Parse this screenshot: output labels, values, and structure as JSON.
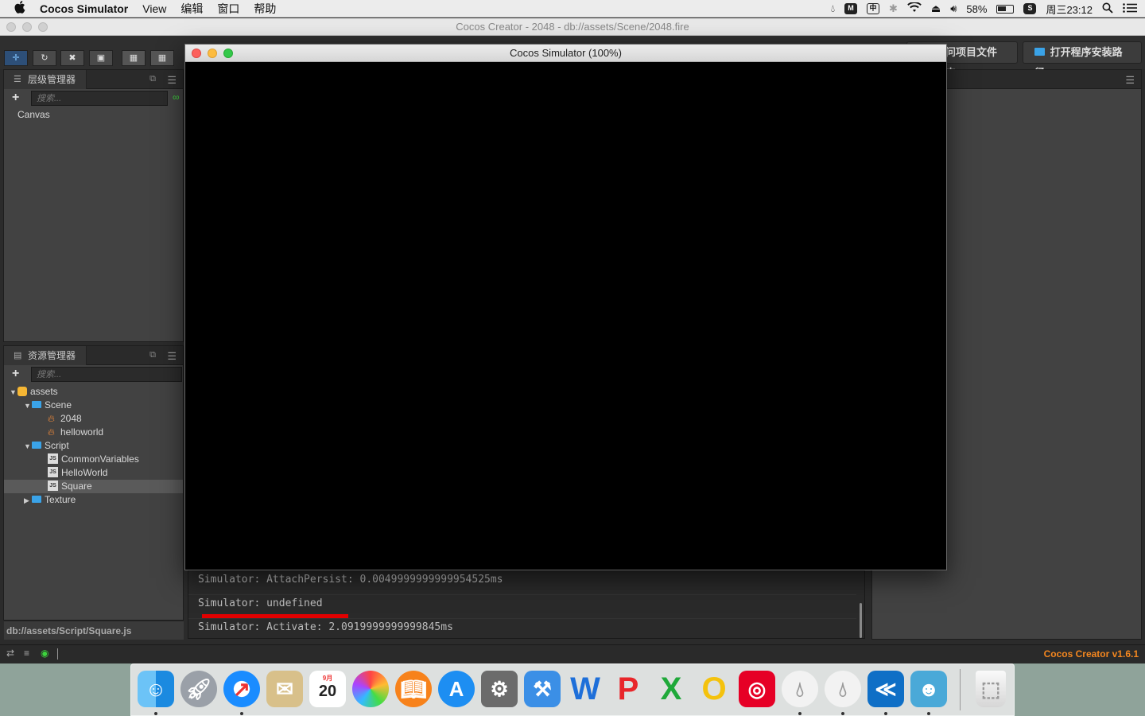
{
  "menubar": {
    "apple": "",
    "app_name": "Cocos Simulator",
    "menus": [
      "View",
      "编辑",
      "窗口",
      "帮助"
    ],
    "battery": "58%",
    "clock": "周三23:12",
    "tray_icons": [
      "droplet-icon",
      "microphone-icon",
      "input-method-icon",
      "bluetooth-icon",
      "wifi-icon",
      "eject-icon",
      "volume-icon",
      "battery-icon",
      "sogou-icon",
      "spotlight-icon",
      "notification-center-icon"
    ]
  },
  "creator": {
    "window_title": "Cocos Creator - 2048 - db://assets/Scene/2048.fire",
    "open_project_folder_label": "问项目文件夹",
    "open_install_path_label": "打开程序安装路径",
    "version": "Cocos Creator v1.6.1",
    "status_path": "db://assets/Script/Square.js"
  },
  "hierarchy": {
    "title": "层级管理器",
    "search_placeholder": "搜索...",
    "root": "Canvas"
  },
  "assets": {
    "title": "资源管理器",
    "search_placeholder": "搜索...",
    "tree": {
      "root": "assets",
      "scene_folder": "Scene",
      "scene_items": [
        "2048",
        "helloworld"
      ],
      "script_folder": "Script",
      "script_items": [
        "CommonVariables",
        "HelloWorld",
        "Square"
      ],
      "texture_folder": "Texture"
    }
  },
  "simulator": {
    "title": "Cocos Simulator (100%)"
  },
  "console": {
    "lines": [
      "Simulator: AttachPersist: 0.0049999999999954525ms",
      "Simulator: undefined",
      "Simulator: Activate: 2.0919999999999845ms"
    ]
  },
  "dock": {
    "apps": [
      "finder",
      "launchpad",
      "safari",
      "mail",
      "calendar",
      "photos",
      "ibooks",
      "app-store",
      "system-preferences",
      "xcode",
      "wps-writer",
      "wps-presentation",
      "wps-spreadsheet",
      "qq-browser",
      "netease-music",
      "app-droplet-1",
      "app-droplet-2",
      "vscode",
      "cocos-creator",
      "trash"
    ],
    "calendar_month": "9月",
    "calendar_day": "20"
  },
  "colors": {
    "accent_orange": "#f5871f",
    "underline_red": "#e10000",
    "folder_blue": "#3aa3e8"
  }
}
